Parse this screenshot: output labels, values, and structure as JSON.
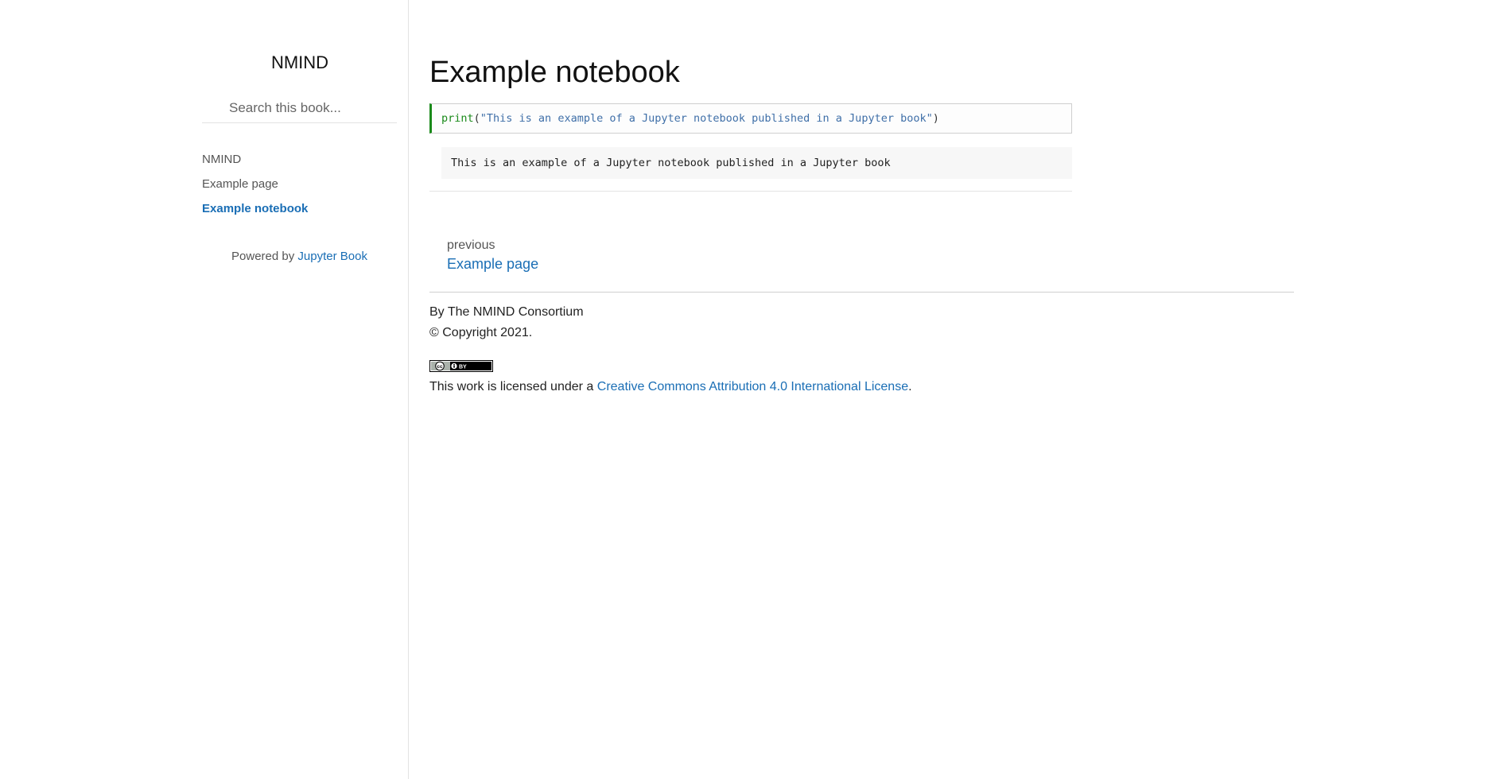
{
  "sidebar": {
    "brand": "NMIND",
    "search": {
      "placeholder": "Search this book...",
      "icon": "search-icon"
    },
    "items": [
      {
        "label": "NMIND"
      },
      {
        "label": "Example page"
      },
      {
        "label": "Example notebook",
        "active": true
      }
    ],
    "powered_prefix": "Powered by ",
    "powered_link": "Jupyter Book"
  },
  "main": {
    "title": "Example notebook",
    "code_cell": {
      "fn": "print",
      "open": "(",
      "string": "\"This is an example of a Jupyter notebook published in a Jupyter book\"",
      "close": ")"
    },
    "output": "This is an example of a Jupyter notebook published in a Jupyter book",
    "prev": {
      "label": "previous",
      "title": "Example page"
    }
  },
  "footer": {
    "author": "By The NMIND Consortium",
    "copyright": "© Copyright 2021.",
    "license_badge_text": "BY",
    "license_prefix": "This work is licensed under a ",
    "license_link": "Creative Commons Attribution 4.0 International License",
    "license_suffix": "."
  },
  "colors": {
    "link": "#1a6eb5",
    "code_accent": "#1a8a1a"
  }
}
